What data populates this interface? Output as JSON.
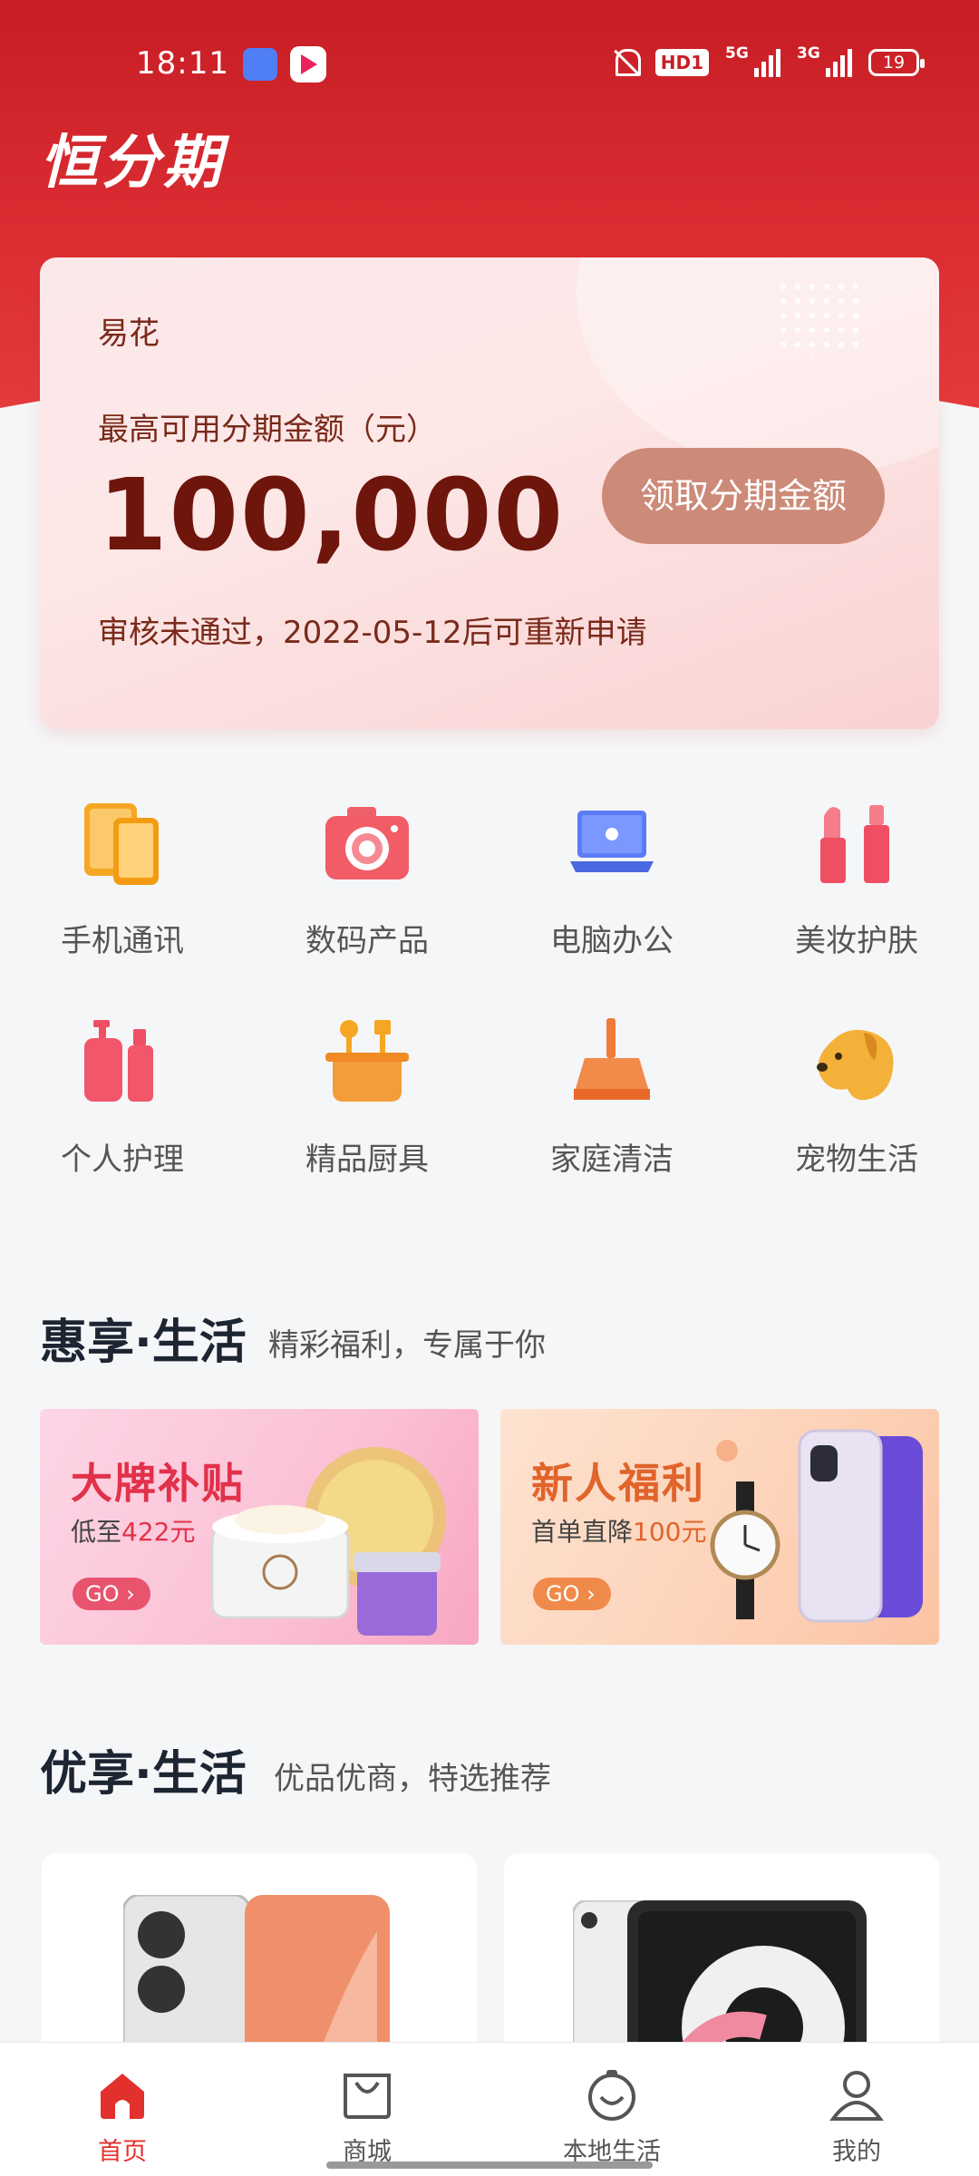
{
  "status_bar": {
    "time": "18:11",
    "hd_label": "HD1",
    "signal1_label": "5G",
    "signal2_label": "3G",
    "battery": "19"
  },
  "header": {
    "title": "恒分期"
  },
  "credit_card": {
    "provider": "易花",
    "label": "最高可用分期金额（元）",
    "amount": "100,000",
    "claim_button": "领取分期金额",
    "note": "审核未通过，2022-05-12后可重新申请"
  },
  "categories": [
    {
      "label": "手机通讯",
      "icon": "phone-icon"
    },
    {
      "label": "数码产品",
      "icon": "camera-icon"
    },
    {
      "label": "电脑办公",
      "icon": "laptop-icon"
    },
    {
      "label": "美妆护肤",
      "icon": "lipstick-icon"
    },
    {
      "label": "个人护理",
      "icon": "lotion-icon"
    },
    {
      "label": "精品厨具",
      "icon": "cookware-icon"
    },
    {
      "label": "家庭清洁",
      "icon": "broom-icon"
    },
    {
      "label": "宠物生活",
      "icon": "dog-icon"
    }
  ],
  "section1": {
    "title": "惠享·生活",
    "subtitle": "精彩福利，专属于你"
  },
  "promos": [
    {
      "title": "大牌补贴",
      "desc_prefix": "低至",
      "desc_highlight": "422元",
      "go": "GO",
      "title_color": "#e2314a"
    },
    {
      "title": "新人福利",
      "desc_prefix": "首单直降",
      "desc_highlight": "100元",
      "go": "GO",
      "title_color": "#e0642b"
    }
  ],
  "section2": {
    "title": "优享·生活",
    "subtitle": "优品优商，特选推荐"
  },
  "tabs": [
    {
      "label": "首页",
      "icon": "home-icon",
      "active": true
    },
    {
      "label": "商城",
      "icon": "shopping-bag-icon",
      "active": false
    },
    {
      "label": "本地生活",
      "icon": "local-life-icon",
      "active": false
    },
    {
      "label": "我的",
      "icon": "profile-icon",
      "active": false
    }
  ],
  "colors": {
    "primary": "#c81d25",
    "accent": "#e2312d",
    "claim_button": "#cc8a78"
  }
}
